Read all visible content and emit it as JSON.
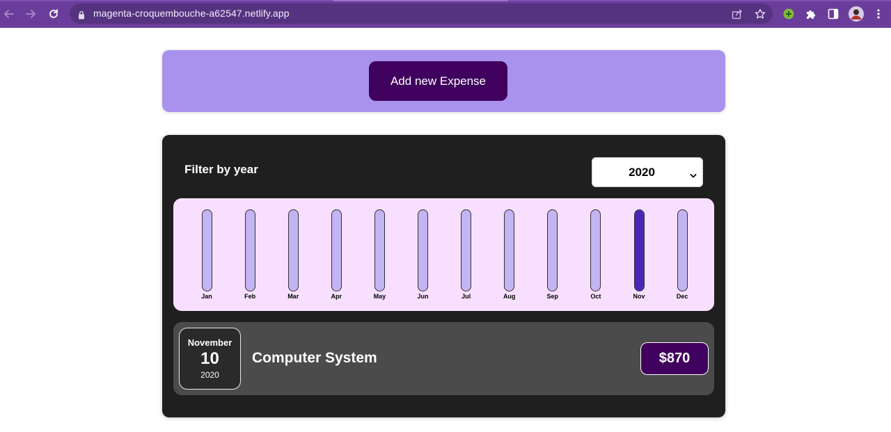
{
  "browser": {
    "url": "magenta-croquembouche-a62547.netlify.app",
    "colors": {
      "frame": "#6a3d9a",
      "omnibox": "#563380"
    },
    "icons": [
      "back-icon",
      "forward-icon",
      "reload-icon",
      "lock-icon",
      "share-icon",
      "bookmark-star-icon",
      "extension-green-icon",
      "puzzle-extensions-icon",
      "side-panel-icon",
      "profile-avatar-icon",
      "menu-kebab-icon"
    ]
  },
  "new_expense": {
    "add_button_label": "Add new Expense",
    "colors": {
      "panel": "#a892ee",
      "button": "#40005d"
    }
  },
  "expenses": {
    "filter": {
      "label": "Filter by year",
      "selected_year": "2020"
    },
    "chart": {
      "months": [
        "Jan",
        "Feb",
        "Mar",
        "Apr",
        "May",
        "Jun",
        "Jul",
        "Aug",
        "Sep",
        "Oct",
        "Nov",
        "Dec"
      ],
      "fill_fraction": [
        0,
        0,
        0,
        0,
        0,
        0,
        0,
        0,
        0,
        0,
        1,
        0
      ],
      "colors": {
        "background": "#f8dfff",
        "bar_empty": "#c3b4f3",
        "bar_fill": "#4826b9"
      }
    },
    "items": [
      {
        "month": "November",
        "day": "10",
        "year": "2020",
        "title": "Computer System",
        "price": "$870"
      }
    ]
  }
}
